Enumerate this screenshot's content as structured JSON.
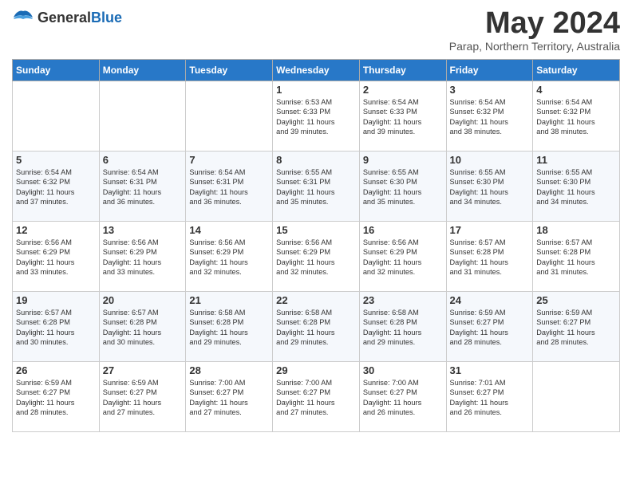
{
  "logo": {
    "general": "General",
    "blue": "Blue"
  },
  "title": "May 2024",
  "subtitle": "Parap, Northern Territory, Australia",
  "days_header": [
    "Sunday",
    "Monday",
    "Tuesday",
    "Wednesday",
    "Thursday",
    "Friday",
    "Saturday"
  ],
  "weeks": [
    [
      {
        "day": "",
        "detail": ""
      },
      {
        "day": "",
        "detail": ""
      },
      {
        "day": "",
        "detail": ""
      },
      {
        "day": "1",
        "detail": "Sunrise: 6:53 AM\nSunset: 6:33 PM\nDaylight: 11 hours\nand 39 minutes."
      },
      {
        "day": "2",
        "detail": "Sunrise: 6:54 AM\nSunset: 6:33 PM\nDaylight: 11 hours\nand 39 minutes."
      },
      {
        "day": "3",
        "detail": "Sunrise: 6:54 AM\nSunset: 6:32 PM\nDaylight: 11 hours\nand 38 minutes."
      },
      {
        "day": "4",
        "detail": "Sunrise: 6:54 AM\nSunset: 6:32 PM\nDaylight: 11 hours\nand 38 minutes."
      }
    ],
    [
      {
        "day": "5",
        "detail": "Sunrise: 6:54 AM\nSunset: 6:32 PM\nDaylight: 11 hours\nand 37 minutes."
      },
      {
        "day": "6",
        "detail": "Sunrise: 6:54 AM\nSunset: 6:31 PM\nDaylight: 11 hours\nand 36 minutes."
      },
      {
        "day": "7",
        "detail": "Sunrise: 6:54 AM\nSunset: 6:31 PM\nDaylight: 11 hours\nand 36 minutes."
      },
      {
        "day": "8",
        "detail": "Sunrise: 6:55 AM\nSunset: 6:31 PM\nDaylight: 11 hours\nand 35 minutes."
      },
      {
        "day": "9",
        "detail": "Sunrise: 6:55 AM\nSunset: 6:30 PM\nDaylight: 11 hours\nand 35 minutes."
      },
      {
        "day": "10",
        "detail": "Sunrise: 6:55 AM\nSunset: 6:30 PM\nDaylight: 11 hours\nand 34 minutes."
      },
      {
        "day": "11",
        "detail": "Sunrise: 6:55 AM\nSunset: 6:30 PM\nDaylight: 11 hours\nand 34 minutes."
      }
    ],
    [
      {
        "day": "12",
        "detail": "Sunrise: 6:56 AM\nSunset: 6:29 PM\nDaylight: 11 hours\nand 33 minutes."
      },
      {
        "day": "13",
        "detail": "Sunrise: 6:56 AM\nSunset: 6:29 PM\nDaylight: 11 hours\nand 33 minutes."
      },
      {
        "day": "14",
        "detail": "Sunrise: 6:56 AM\nSunset: 6:29 PM\nDaylight: 11 hours\nand 32 minutes."
      },
      {
        "day": "15",
        "detail": "Sunrise: 6:56 AM\nSunset: 6:29 PM\nDaylight: 11 hours\nand 32 minutes."
      },
      {
        "day": "16",
        "detail": "Sunrise: 6:56 AM\nSunset: 6:29 PM\nDaylight: 11 hours\nand 32 minutes."
      },
      {
        "day": "17",
        "detail": "Sunrise: 6:57 AM\nSunset: 6:28 PM\nDaylight: 11 hours\nand 31 minutes."
      },
      {
        "day": "18",
        "detail": "Sunrise: 6:57 AM\nSunset: 6:28 PM\nDaylight: 11 hours\nand 31 minutes."
      }
    ],
    [
      {
        "day": "19",
        "detail": "Sunrise: 6:57 AM\nSunset: 6:28 PM\nDaylight: 11 hours\nand 30 minutes."
      },
      {
        "day": "20",
        "detail": "Sunrise: 6:57 AM\nSunset: 6:28 PM\nDaylight: 11 hours\nand 30 minutes."
      },
      {
        "day": "21",
        "detail": "Sunrise: 6:58 AM\nSunset: 6:28 PM\nDaylight: 11 hours\nand 29 minutes."
      },
      {
        "day": "22",
        "detail": "Sunrise: 6:58 AM\nSunset: 6:28 PM\nDaylight: 11 hours\nand 29 minutes."
      },
      {
        "day": "23",
        "detail": "Sunrise: 6:58 AM\nSunset: 6:28 PM\nDaylight: 11 hours\nand 29 minutes."
      },
      {
        "day": "24",
        "detail": "Sunrise: 6:59 AM\nSunset: 6:27 PM\nDaylight: 11 hours\nand 28 minutes."
      },
      {
        "day": "25",
        "detail": "Sunrise: 6:59 AM\nSunset: 6:27 PM\nDaylight: 11 hours\nand 28 minutes."
      }
    ],
    [
      {
        "day": "26",
        "detail": "Sunrise: 6:59 AM\nSunset: 6:27 PM\nDaylight: 11 hours\nand 28 minutes."
      },
      {
        "day": "27",
        "detail": "Sunrise: 6:59 AM\nSunset: 6:27 PM\nDaylight: 11 hours\nand 27 minutes."
      },
      {
        "day": "28",
        "detail": "Sunrise: 7:00 AM\nSunset: 6:27 PM\nDaylight: 11 hours\nand 27 minutes."
      },
      {
        "day": "29",
        "detail": "Sunrise: 7:00 AM\nSunset: 6:27 PM\nDaylight: 11 hours\nand 27 minutes."
      },
      {
        "day": "30",
        "detail": "Sunrise: 7:00 AM\nSunset: 6:27 PM\nDaylight: 11 hours\nand 26 minutes."
      },
      {
        "day": "31",
        "detail": "Sunrise: 7:01 AM\nSunset: 6:27 PM\nDaylight: 11 hours\nand 26 minutes."
      },
      {
        "day": "",
        "detail": ""
      }
    ]
  ]
}
